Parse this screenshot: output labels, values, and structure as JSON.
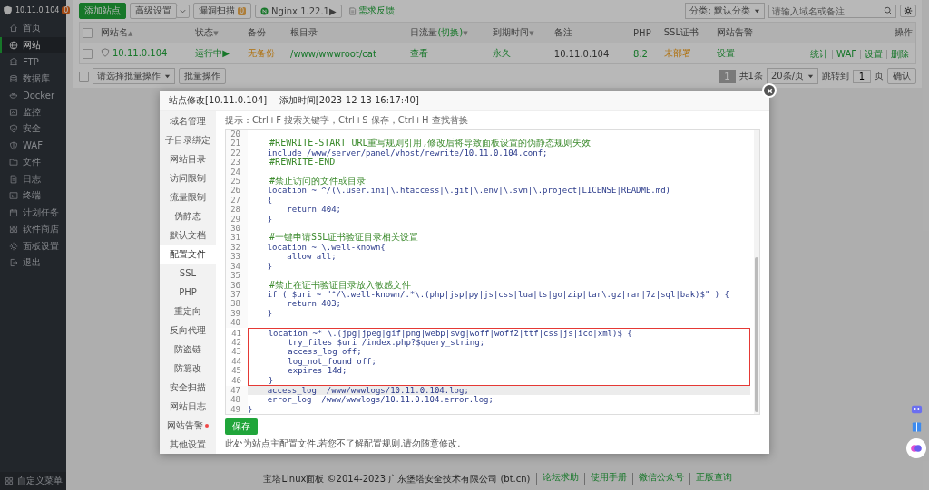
{
  "sidebar": {
    "host": "10.11.0.104",
    "badge": "0",
    "items": [
      {
        "label": "首页",
        "selected": false
      },
      {
        "label": "网站",
        "selected": true
      },
      {
        "label": "FTP",
        "selected": false
      },
      {
        "label": "数据库",
        "selected": false
      },
      {
        "label": "Docker",
        "selected": false
      },
      {
        "label": "监控",
        "selected": false
      },
      {
        "label": "安全",
        "selected": false
      },
      {
        "label": "WAF",
        "selected": false
      },
      {
        "label": "文件",
        "selected": false
      },
      {
        "label": "日志",
        "selected": false
      },
      {
        "label": "终端",
        "selected": false
      },
      {
        "label": "计划任务",
        "selected": false
      },
      {
        "label": "软件商店",
        "selected": false
      },
      {
        "label": "面板设置",
        "selected": false
      },
      {
        "label": "退出",
        "selected": false
      }
    ],
    "footer": "自定义菜单"
  },
  "toolbar": {
    "buttons": [
      {
        "label": "添加站点",
        "kind": "primary"
      },
      {
        "label": "高级设置",
        "kind": "dropdown"
      },
      {
        "label": "漏洞扫描",
        "kind": "badge",
        "badge": "0"
      },
      {
        "label": "Nginx 1.22.1▶",
        "kind": "service"
      },
      {
        "label": "需求反馈",
        "kind": "link"
      }
    ],
    "category": "分类: 默认分类",
    "search": {
      "placeholder": "请输入域名或备注"
    }
  },
  "table": {
    "header_checked": false,
    "columns": [
      {
        "label": "网站名",
        "sort": "▲"
      },
      {
        "label": "状态",
        "sort": "▼"
      },
      {
        "label": "备份"
      },
      {
        "label": "根目录"
      },
      {
        "label": "日流量",
        "link": "(切换)",
        "sort": "▼"
      },
      {
        "label": "到期时间",
        "sort": "▼"
      },
      {
        "label": "备注"
      },
      {
        "label": "PHP"
      },
      {
        "label": "SSL证书"
      },
      {
        "label": "网站告警"
      },
      {
        "label": "操作"
      }
    ],
    "rows": [
      {
        "checked": false,
        "cells": [
          {
            "text": "10.11.0.104",
            "kind": "link"
          },
          {
            "text": "运行中▶",
            "kind": "link"
          },
          {
            "text": "无备份",
            "kind": "warning"
          },
          {
            "text": "/www/wwwroot/cat",
            "kind": "link"
          },
          {
            "text": "查看",
            "kind": "link"
          },
          {
            "text": "永久",
            "kind": "link"
          },
          {
            "text": "10.11.0.104",
            "kind": "plain"
          },
          {
            "text": "8.2",
            "kind": "link"
          },
          {
            "text": "未部署",
            "kind": "warning"
          },
          {
            "text": "设置",
            "kind": "link"
          }
        ],
        "actions": [
          "统计",
          "WAF",
          "设置",
          "删除"
        ]
      }
    ]
  },
  "batch": {
    "checked": false,
    "select": "请选择批量操作",
    "button": "批量操作"
  },
  "pagination": {
    "pages": [
      {
        "label": "1",
        "selected": true
      }
    ],
    "total": "共1条",
    "per_page": "20条/页",
    "jump_label": "跳转到",
    "jump_value": "1",
    "unit": "页",
    "confirm": "确认"
  },
  "footer": {
    "copyright": "宝塔Linux面板 ©2014-2023 广东堡塔安全技术有限公司 (bt.cn)",
    "links": [
      "论坛求助",
      "使用手册",
      "微信公众号",
      "正版查询"
    ]
  },
  "modal": {
    "title": "站点修改[10.11.0.104] -- 添加时间[2023-12-13 16:17:40]",
    "tabs": [
      {
        "label": "域名管理",
        "selected": false
      },
      {
        "label": "子目录绑定",
        "selected": false
      },
      {
        "label": "网站目录",
        "selected": false
      },
      {
        "label": "访问限制",
        "selected": false
      },
      {
        "label": "流量限制",
        "selected": false
      },
      {
        "label": "伪静态",
        "selected": false
      },
      {
        "label": "默认文档",
        "selected": false
      },
      {
        "label": "配置文件",
        "selected": true
      },
      {
        "label": "SSL",
        "selected": false
      },
      {
        "label": "PHP",
        "selected": false
      },
      {
        "label": "重定向",
        "selected": false
      },
      {
        "label": "反向代理",
        "selected": false
      },
      {
        "label": "防盗链",
        "selected": false
      },
      {
        "label": "防篡改",
        "selected": false
      },
      {
        "label": "安全扫描",
        "selected": false
      },
      {
        "label": "网站日志",
        "selected": false
      },
      {
        "label": "网站告警",
        "selected": false,
        "dot": true
      },
      {
        "label": "其他设置",
        "selected": false
      }
    ],
    "hint": "提示：Ctrl+F 搜索关键字，Ctrl+S 保存，Ctrl+H 查找替换",
    "code_blocks": [
      {
        "boxed": false,
        "lines": [
          {
            "n": "20",
            "selected": false
          },
          {
            "n": "21",
            "t": "    #REWRITE-START URL重写规则引用,修改后将导致面板设置的伪静态规则失效",
            "kind": "comment",
            "selected": false
          },
          {
            "n": "22",
            "t": "    include /www/server/panel/vhost/rewrite/10.11.0.104.conf;",
            "kind": "code",
            "selected": false
          },
          {
            "n": "23",
            "t": "    #REWRITE-END",
            "kind": "comment",
            "selected": false
          },
          {
            "n": "24",
            "selected": false
          },
          {
            "n": "25",
            "t": "    #禁止访问的文件或目录",
            "kind": "comment",
            "selected": false
          },
          {
            "n": "26",
            "t": "    location ~ ^/(\\.user.ini|\\.htaccess|\\.git|\\.env|\\.svn|\\.project|LICENSE|README.md)",
            "kind": "code",
            "selected": false
          },
          {
            "n": "27",
            "t": "    {",
            "kind": "code",
            "selected": false
          },
          {
            "n": "28",
            "t": "        return 404;",
            "kind": "code",
            "selected": false
          },
          {
            "n": "29",
            "t": "    }",
            "kind": "code",
            "selected": false
          },
          {
            "n": "30",
            "selected": false
          },
          {
            "n": "31",
            "t": "    #一键申请SSL证书验证目录相关设置",
            "kind": "comment",
            "selected": false
          },
          {
            "n": "32",
            "t": "    location ~ \\.well-known{",
            "kind": "code",
            "selected": false
          },
          {
            "n": "33",
            "t": "        allow all;",
            "kind": "code",
            "selected": false
          },
          {
            "n": "34",
            "t": "    }",
            "kind": "code",
            "selected": false
          },
          {
            "n": "35",
            "selected": false
          },
          {
            "n": "36",
            "t": "    #禁止在证书验证目录放入敏感文件",
            "kind": "comment",
            "selected": false
          },
          {
            "n": "37",
            "t": "    if ( $uri ~ \"^/\\.well-known/.*\\.(php|jsp|py|js|css|lua|ts|go|zip|tar\\.gz|rar|7z|sql|bak)$\" ) {",
            "kind": "code",
            "selected": false
          },
          {
            "n": "38",
            "t": "        return 403;",
            "kind": "code",
            "selected": false
          },
          {
            "n": "39",
            "t": "    }",
            "kind": "code",
            "selected": false
          },
          {
            "n": "40",
            "selected": false
          }
        ]
      },
      {
        "boxed": true,
        "lines": [
          {
            "n": "41",
            "t": "    location ~* \\.(jpg|jpeg|gif|png|webp|svg|woff|woff2|ttf|css|js|ico|xml)$ {",
            "kind": "code",
            "selected": false
          },
          {
            "n": "42",
            "t": "        try_files $uri /index.php?$query_string;",
            "kind": "code",
            "selected": false
          },
          {
            "n": "43",
            "t": "        access_log off;",
            "kind": "code",
            "selected": false
          },
          {
            "n": "44",
            "t": "        log_not_found off;",
            "kind": "code",
            "selected": false
          },
          {
            "n": "45",
            "t": "        expires 14d;",
            "kind": "code",
            "selected": false
          },
          {
            "n": "46",
            "t": "    }",
            "kind": "code",
            "selected": false
          }
        ]
      },
      {
        "boxed": false,
        "lines": [
          {
            "n": "47",
            "t": "    access_log  /www/wwwlogs/10.11.0.104.log;",
            "kind": "code",
            "selected": true
          },
          {
            "n": "48",
            "t": "    error_log  /www/wwwlogs/10.11.0.104.error.log;",
            "kind": "code",
            "selected": false
          },
          {
            "n": "49",
            "t": "}",
            "kind": "code",
            "selected": false
          }
        ]
      }
    ],
    "save": "保存",
    "note": "此处为站点主配置文件,若您不了解配置规则,请勿随意修改."
  }
}
